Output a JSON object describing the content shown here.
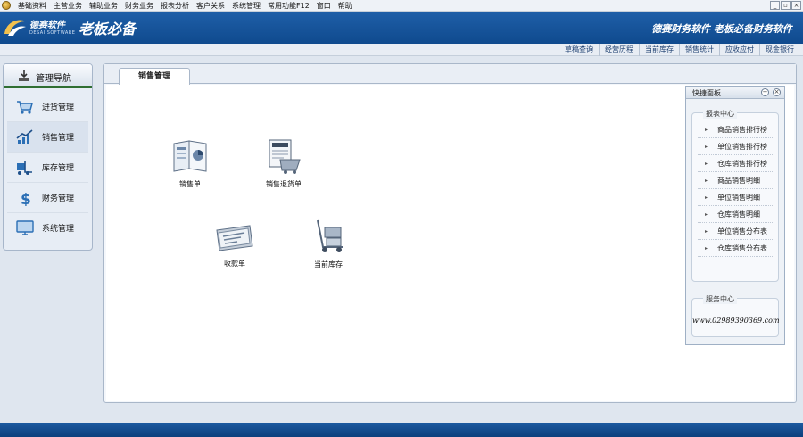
{
  "menubar": {
    "items": [
      "基础资料",
      "主营业务",
      "辅助业务",
      "财务业务",
      "报表分析",
      "客户关系",
      "系统管理",
      "常用功能F12",
      "窗口",
      "帮助"
    ],
    "window_controls": [
      "_",
      "▫",
      "×"
    ]
  },
  "banner": {
    "logo_text": "德赛软件",
    "logo_subtitle": "DESAI SOFTWARE",
    "slogan": "老板必备",
    "right_text": "德赛财务软件 老板必备财务软件"
  },
  "quick_links": [
    "草稿查询",
    "经营历程",
    "当前库存",
    "销售统计",
    "应收应付",
    "现金银行"
  ],
  "nav": {
    "title": "管理导航",
    "items": [
      {
        "label": "进货管理",
        "icon": "cart-icon"
      },
      {
        "label": "销售管理",
        "icon": "trend-chart-icon"
      },
      {
        "label": "库存管理",
        "icon": "forklift-icon"
      },
      {
        "label": "财务管理",
        "icon": "dollar-icon"
      },
      {
        "label": "系统管理",
        "icon": "monitor-icon"
      }
    ],
    "active_index": 1
  },
  "main": {
    "tab_label": "销售管理",
    "functions": [
      {
        "label": "销售单",
        "icon": "sales-order-icon"
      },
      {
        "label": "销售退货单",
        "icon": "sales-return-icon"
      },
      {
        "label": "收款单",
        "icon": "receipt-icon"
      },
      {
        "label": "当前库存",
        "icon": "inventory-cart-icon"
      }
    ]
  },
  "quick_panel": {
    "title": "快捷面板",
    "report_center": {
      "title": "报表中心",
      "items": [
        "商品销售排行榜",
        "单位销售排行榜",
        "仓库销售排行榜",
        "商品销售明细",
        "单位销售明细",
        "仓库销售明细",
        "单位销售分布表",
        "仓库销售分布表"
      ]
    },
    "service_center": {
      "title": "服务中心",
      "phone": "www.02989390369.com"
    }
  },
  "colors": {
    "banner": "#1f5fa8",
    "nav_active_bar": "#2f6e32",
    "bottom_bar": "#0c3f7c"
  }
}
